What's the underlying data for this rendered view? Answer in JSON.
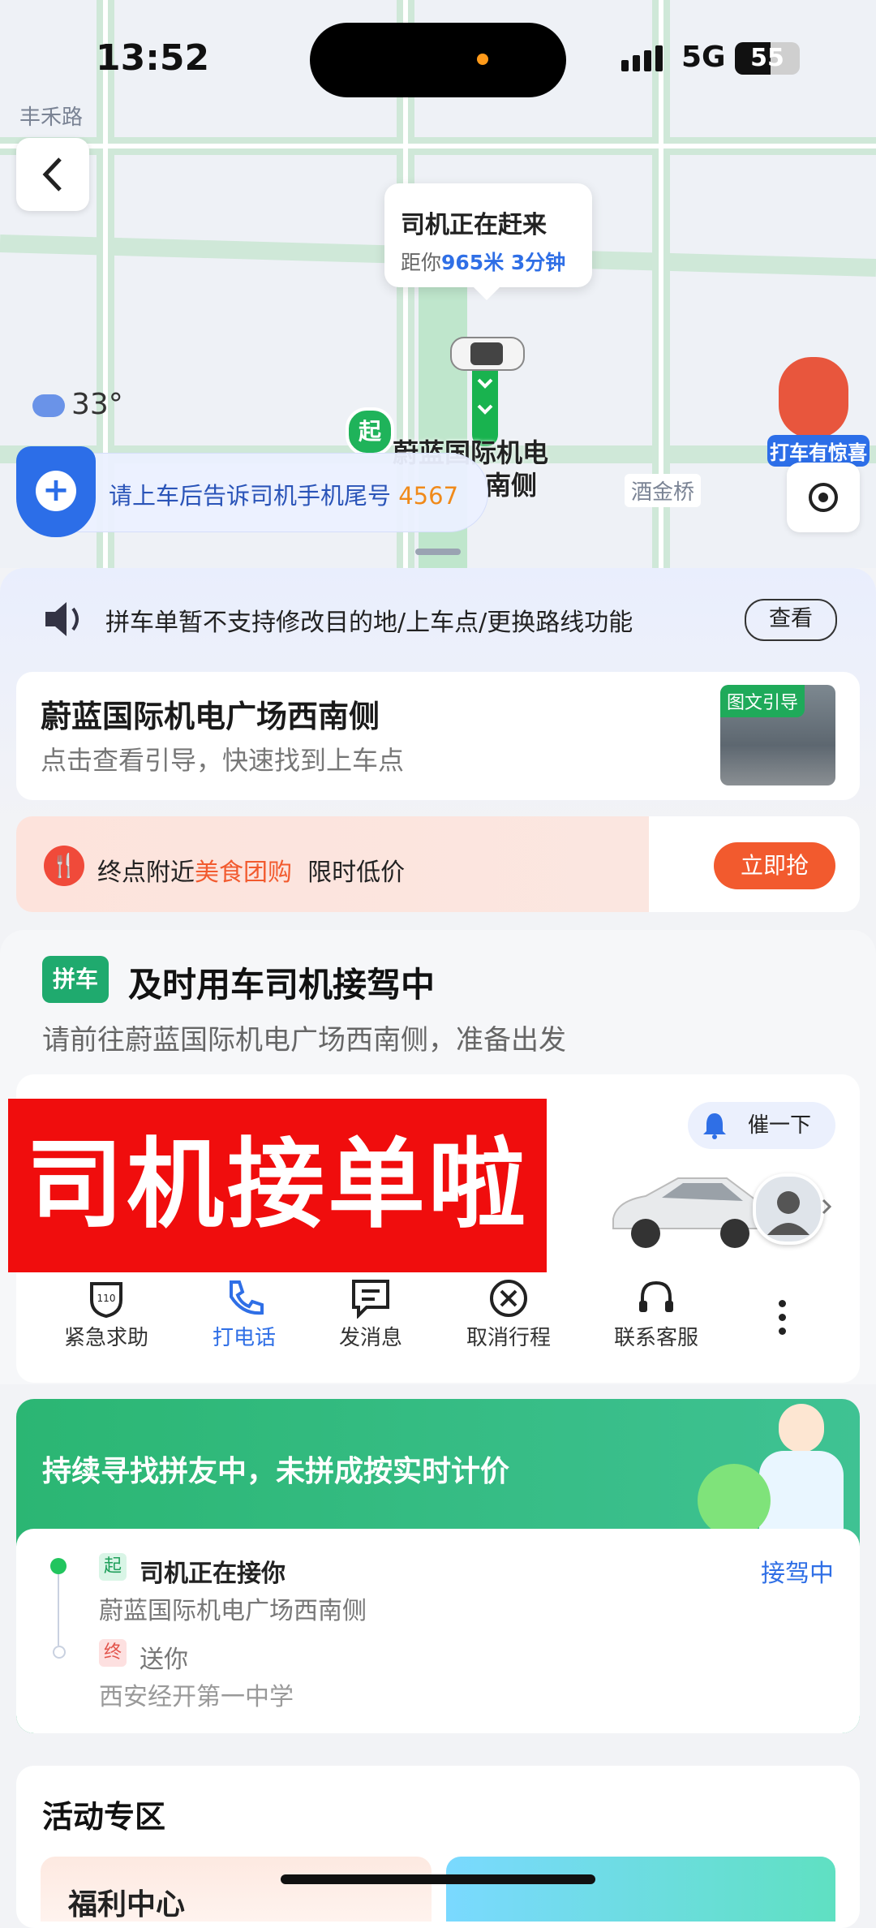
{
  "status_bar": {
    "time": "13:52",
    "network": "5G",
    "battery": "55",
    "battery_level": 0.55
  },
  "map": {
    "road_label_1": "丰禾路",
    "road_label_2": "酒金桥",
    "callout_title": "司机正在赶来",
    "callout_prefix": "距你",
    "callout_distance": "965米 3分钟",
    "weather_temp": "33°",
    "start_pin": "起",
    "pickup_label_line1": "蔚蓝国际机电",
    "pickup_label_line2": "南侧",
    "phone_notice_prefix": "请上车后告诉司机手机尾号",
    "phone_tail": "4567",
    "promo_label": "打车有惊喜"
  },
  "banner": {
    "text": "拼车单暂不支持修改目的地/上车点/更换路线功能",
    "view_label": "查看"
  },
  "guide": {
    "title": "蔚蓝国际机电广场西南侧",
    "subtitle": "点击查看引导，快速找到上车点",
    "thumb_tag": "图文引导"
  },
  "food": {
    "text_prefix": "终点附近",
    "highlight": "美食团购",
    "text_suffix": "限时低价",
    "button": "立即抢"
  },
  "trip": {
    "tag": "拼车",
    "title": "及时用车司机接驾中",
    "subtitle": "请前往蔚蓝国际机电广场西南侧，准备出发",
    "overlay_banner": "司机接单啦",
    "urge_button": "催一下",
    "actions": [
      {
        "label": "紧急求助",
        "icon": "sos-110-icon"
      },
      {
        "label": "打电话",
        "icon": "phone-icon"
      },
      {
        "label": "发消息",
        "icon": "message-icon"
      },
      {
        "label": "取消行程",
        "icon": "cancel-icon"
      },
      {
        "label": "联系客服",
        "icon": "headset-icon"
      }
    ]
  },
  "carpool": {
    "text": "持续寻找拼友中，未拼成按实时计价",
    "start_tag": "起",
    "start_title": "司机正在接你",
    "start_place": "蔚蓝国际机电广场西南侧",
    "status": "接驾中",
    "end_tag": "终",
    "end_title": "送你",
    "end_place": "西安经开第一中学"
  },
  "activity": {
    "title": "活动专区",
    "item_1": "福利中心"
  },
  "colors": {
    "accent": "#2f6fe6",
    "green": "#1faa6e",
    "orange": "#f25a2e",
    "red_banner": "#f00d0d"
  }
}
